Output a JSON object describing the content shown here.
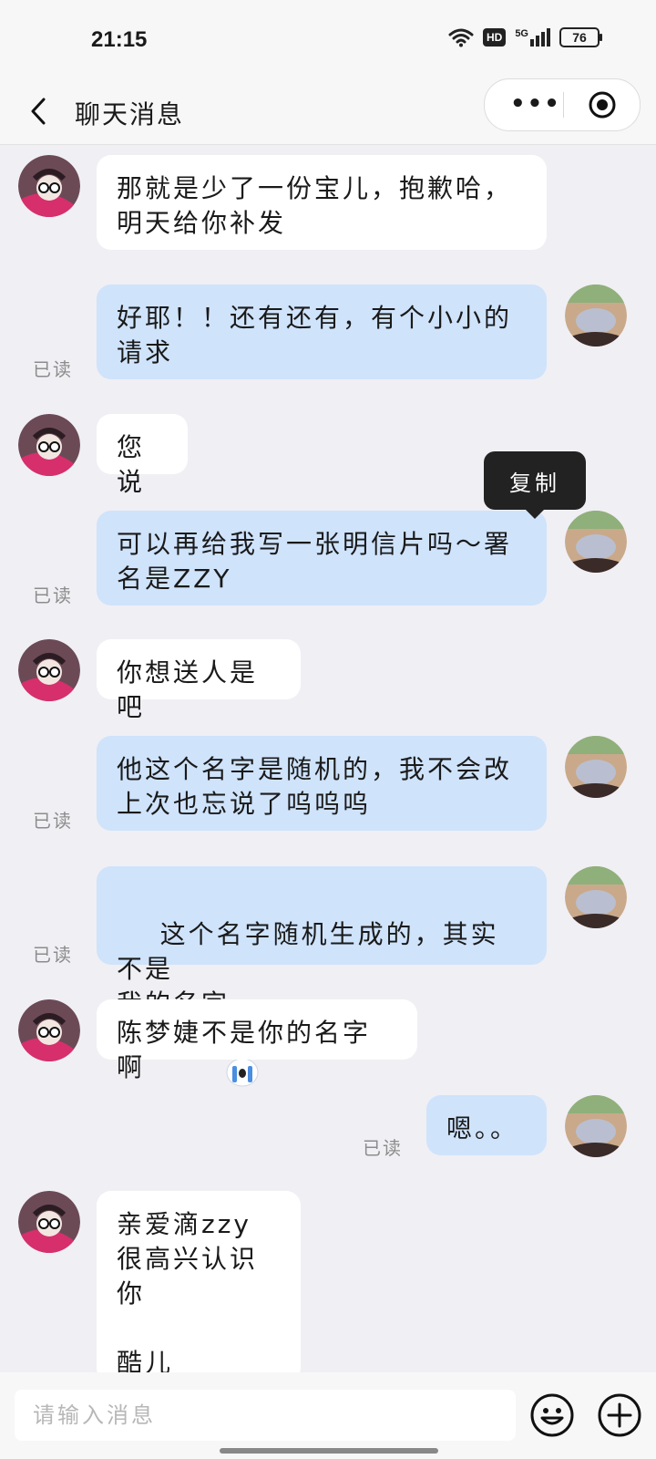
{
  "status_bar": {
    "time": "21:15",
    "hd": "HD",
    "network": "5G",
    "battery": "76",
    "icons": [
      "wifi-icon",
      "signal-icon",
      "battery-icon"
    ]
  },
  "header": {
    "title": "聊天消息",
    "back_icon": "chevron-left-icon",
    "more_label": "•••",
    "close_icon": "target-icon"
  },
  "tooltip": {
    "label": "复制"
  },
  "messages": [
    {
      "side": "in",
      "text": "那就是少了一份宝儿，抱歉哈，\n明天给你补发"
    },
    {
      "side": "out",
      "text": "好耶！！还有还有，有个小小的\n请求",
      "status": "已读"
    },
    {
      "side": "in",
      "text": "您说"
    },
    {
      "side": "out",
      "text": "可以再给我写一张明信片吗～署\n名是ZZY",
      "status": "已读"
    },
    {
      "side": "in",
      "text": "你想送人是吧"
    },
    {
      "side": "out",
      "text": "他这个名字是随机的，我不会改\n上次也忘说了呜呜呜",
      "status": "已读"
    },
    {
      "side": "out",
      "text": "这个名字随机生成的，其实不是\n我的名字",
      "emoji": "crying-emoji",
      "status": "已读"
    },
    {
      "side": "in",
      "text": "陈梦婕不是你的名字啊"
    },
    {
      "side": "out",
      "text": "嗯。。",
      "status": "已读"
    },
    {
      "side": "in",
      "text": "亲爱滴zzy\n很高兴认识你\n\n酷儿"
    }
  ],
  "input": {
    "placeholder": "请输入消息",
    "emoji_icon": "smiley-icon",
    "add_icon": "plus-circle-icon"
  },
  "colors": {
    "background": "#f0eff4",
    "incoming_bubble": "#ffffff",
    "outgoing_bubble": "#cfe3fb",
    "tooltip": "#222222"
  }
}
